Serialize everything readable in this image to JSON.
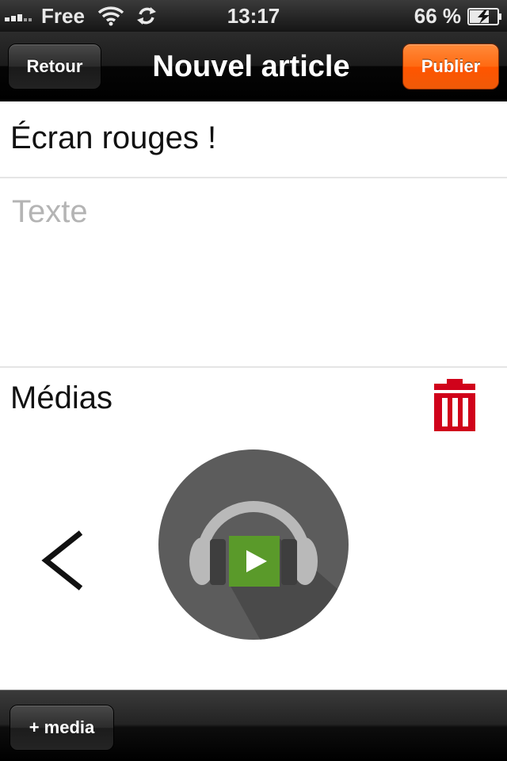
{
  "status_bar": {
    "carrier": "Free",
    "time": "13:17",
    "battery": "66 %",
    "icons": [
      "signal-icon",
      "wifi-icon",
      "sync-icon",
      "battery-charging-icon"
    ]
  },
  "nav": {
    "back_label": "Retour",
    "title": "Nouvel article",
    "publish_label": "Publier"
  },
  "article": {
    "title_value": "Écran rouges !",
    "text_placeholder": "Texte"
  },
  "media": {
    "heading": "Médias",
    "icons": [
      "trash-icon",
      "chevron-left-icon",
      "audio-video-thumbnail"
    ]
  },
  "toolbar": {
    "add_media_label": "+ media"
  },
  "colors": {
    "accent_orange": "#ff6a12",
    "trash_red": "#d0021b",
    "play_green": "#5a9a2a",
    "thumb_gray": "#5a5a5a"
  }
}
